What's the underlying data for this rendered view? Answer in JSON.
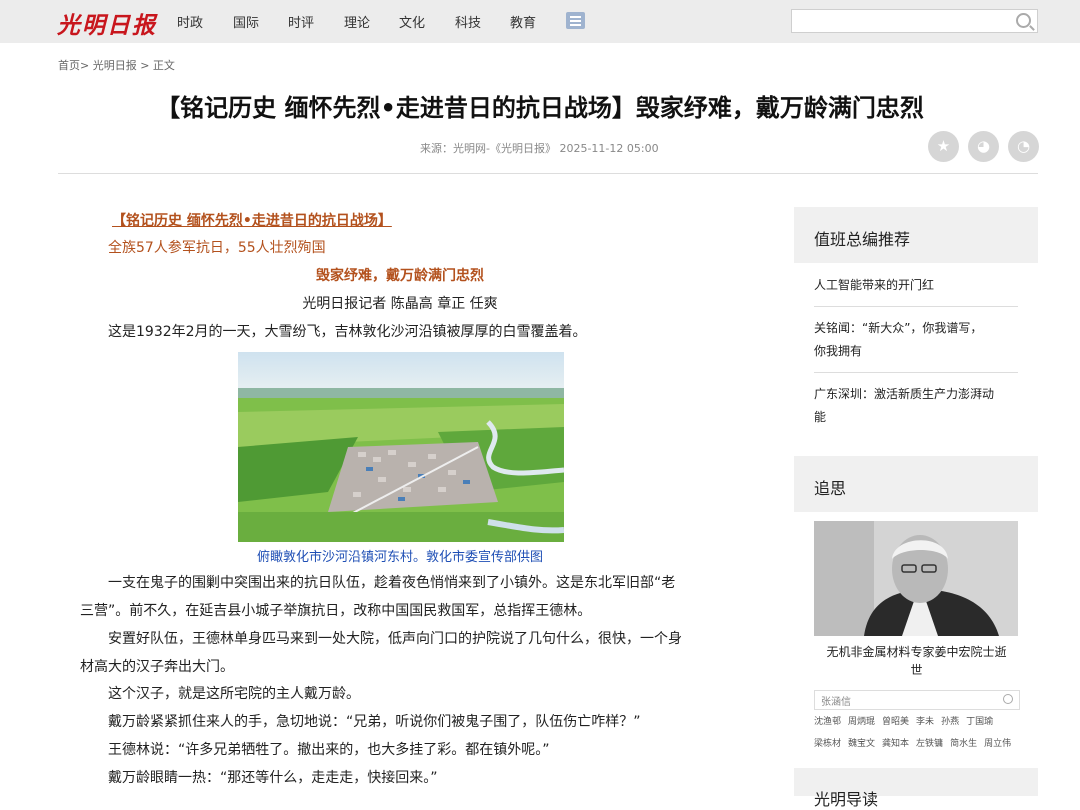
{
  "header": {
    "logo": "光明日报",
    "nav": [
      "时政",
      "国际",
      "时评",
      "理论",
      "文化",
      "科技",
      "教育"
    ],
    "search_placeholder": ""
  },
  "breadcrumb": "首页> 光明日报 > 正文",
  "article": {
    "title": "【铭记历史 缅怀先烈•走进昔日的抗日战场】毁家纾难，戴万龄满门忠烈",
    "meta": "来源：光明网-《光明日报》  2025-11-12 05:00",
    "kicker": "【铭记历史 缅怀先烈•走进昔日的抗日战场】",
    "subhead": "全族57人参军抗日，55人壮烈殉国",
    "headline": "毁家纾难，戴万龄满门忠烈",
    "byline": "光明日报记者 陈晶高 章正 任爽",
    "para1": "这是1932年2月的一天，大雪纷飞，吉林敦化沙河沿镇被厚厚的白雪覆盖着。",
    "caption": "俯瞰敦化市沙河沿镇河东村。敦化市委宣传部供图",
    "para2a": "一支在鬼子的围剿中突围出来的抗日队伍，趁着夜色悄悄来到了小镇外。这是东北军旧部“老",
    "para2b": "三营”。前不久，在延吉县小城子举旗抗日，改称中国国民救国军，总指挥王德林。",
    "para3a": "安置好队伍，王德林单身匹马来到一处大院，低声向门口的护院说了几句什么，很快，一个身",
    "para3b": "材高大的汉子奔出大门。",
    "para4": "这个汉子，就是这所宅院的主人戴万龄。",
    "para5": "戴万龄紧紧抓住来人的手，急切地说：“兄弟，听说你们被鬼子围了，队伍伤亡咋样？”",
    "para6": "王德林说：“许多兄弟牺牲了。撤出来的，也大多挂了彩。都在镇外呢。”",
    "para7": "戴万龄眼睛一热：“那还等什么，走走走，快接回来。”"
  },
  "sidebar": {
    "rec_title": "值班总编推荐",
    "rec_items": [
      "人工智能带来的开门红",
      "关铭闻：“新大众”，你我谱写，",
      "你我拥有",
      "广东深圳：激活新质生产力澎湃动",
      "能"
    ],
    "mem_title": "追思",
    "mem_caption_a": "无机非金属材料专家姜中宏院士逝",
    "mem_caption_b": "世",
    "mem_search": "张涵信",
    "names_row1": [
      "沈渔邨",
      "周炳琨",
      "曾昭美",
      "李未",
      "孙燕",
      "丁国瑜"
    ],
    "names_row2": [
      "梁栋材",
      "魏宝文",
      "龚知本",
      "左铁镛",
      "简水生",
      "周立伟"
    ],
    "next_title": "光明导读"
  }
}
